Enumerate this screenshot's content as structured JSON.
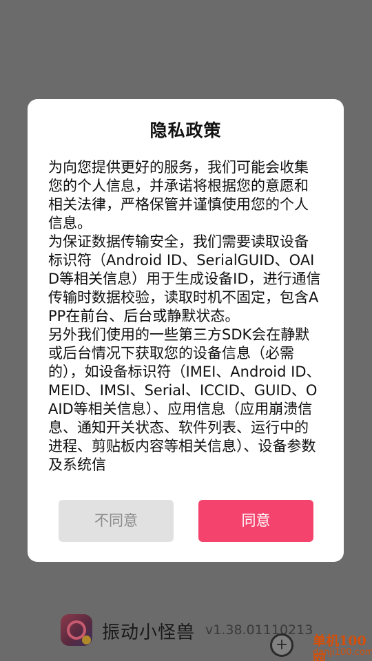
{
  "footer": {
    "app_icon": "app-logo-icon",
    "app_name": "振动小怪兽",
    "version": "v1.38.01110213"
  },
  "watermark": {
    "icon": "plus-circle-icon",
    "icon_glyph": "+",
    "title": "单机100网",
    "url": "danji100.com"
  },
  "dialog": {
    "title": "隐私政策",
    "paragraphs": [
      "为向您提供更好的服务，我们可能会收集您的个人信息，并承诺将根据您的意愿和相关法律，严格保管并谨慎使用您的个人信息。",
      "为保证数据传输安全，我们需要读取设备标识符（Android ID、SerialGUID、OAID等相关信息）用于生成设备ID，进行通信传输时数据校验，读取时机不固定，包含APP在前台、后台或静默状态。",
      "另外我们使用的一些第三方SDK会在静默或后台情况下获取您的设备信息（必需的），如设备标识符（IMEI、Android ID、MEID、IMSI、Serial、ICCID、GUID、OAID等相关信息）、应用信息（应用崩溃信息、通知开关状态、软件列表、运行中的进程、剪贴板内容等相关信息）、设备参数及系统信"
    ],
    "disagree_label": "不同意",
    "agree_label": "同意"
  },
  "colors": {
    "overlay": "#6b6b6b",
    "agree_button": "#f4446e",
    "disagree_button": "#e1e1e1",
    "watermark_accent": "#d4500a"
  }
}
